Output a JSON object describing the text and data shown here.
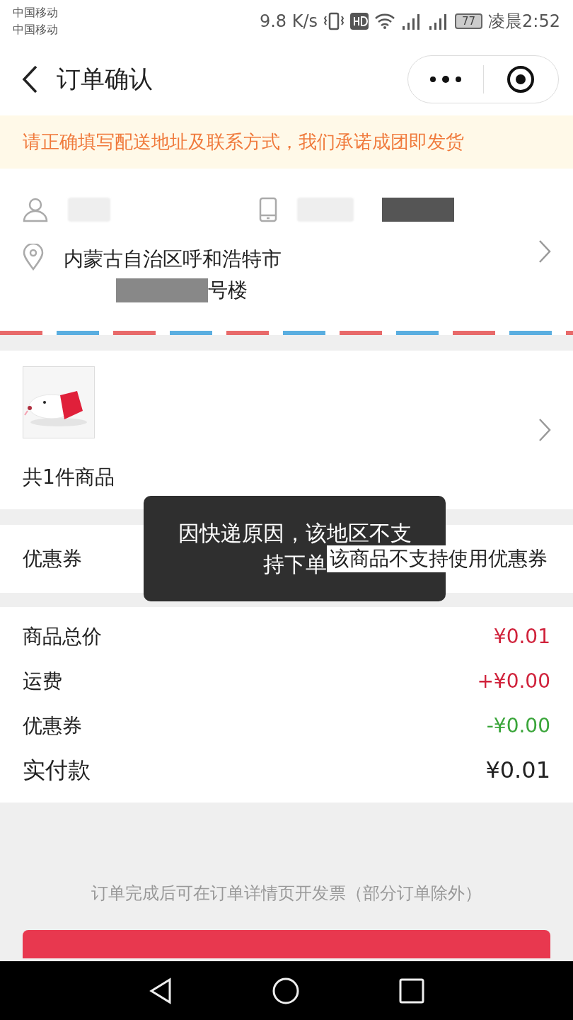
{
  "status_bar": {
    "carriers": [
      "中国移动",
      "中国移动"
    ],
    "speed": "9.8 K/s",
    "battery": "77",
    "time": "凌晨2:52"
  },
  "header": {
    "title": "订单确认"
  },
  "notice": "请正确填写配送地址及联系方式，我们承诺成团即发货",
  "address": {
    "line_1": "内蒙古自治区呼和浩特市",
    "line_2": "号楼"
  },
  "products": {
    "count_label": "共1件商品"
  },
  "coupon": {
    "label": "优惠券",
    "value": "该商品不支持使用优惠券"
  },
  "summary": [
    {
      "label": "商品总价",
      "value": "¥0.01",
      "kind": "price"
    },
    {
      "label": "运费",
      "value": "+¥0.00",
      "kind": "price"
    },
    {
      "label": "优惠券",
      "value": "-¥0.00",
      "kind": "discount"
    },
    {
      "label": "实付款",
      "value": "¥0.01",
      "kind": "total"
    }
  ],
  "invoice_note": "订单完成后可在订单详情页开发票（部分订单除外）",
  "toast": "因快递原因，该地区不支持下单"
}
